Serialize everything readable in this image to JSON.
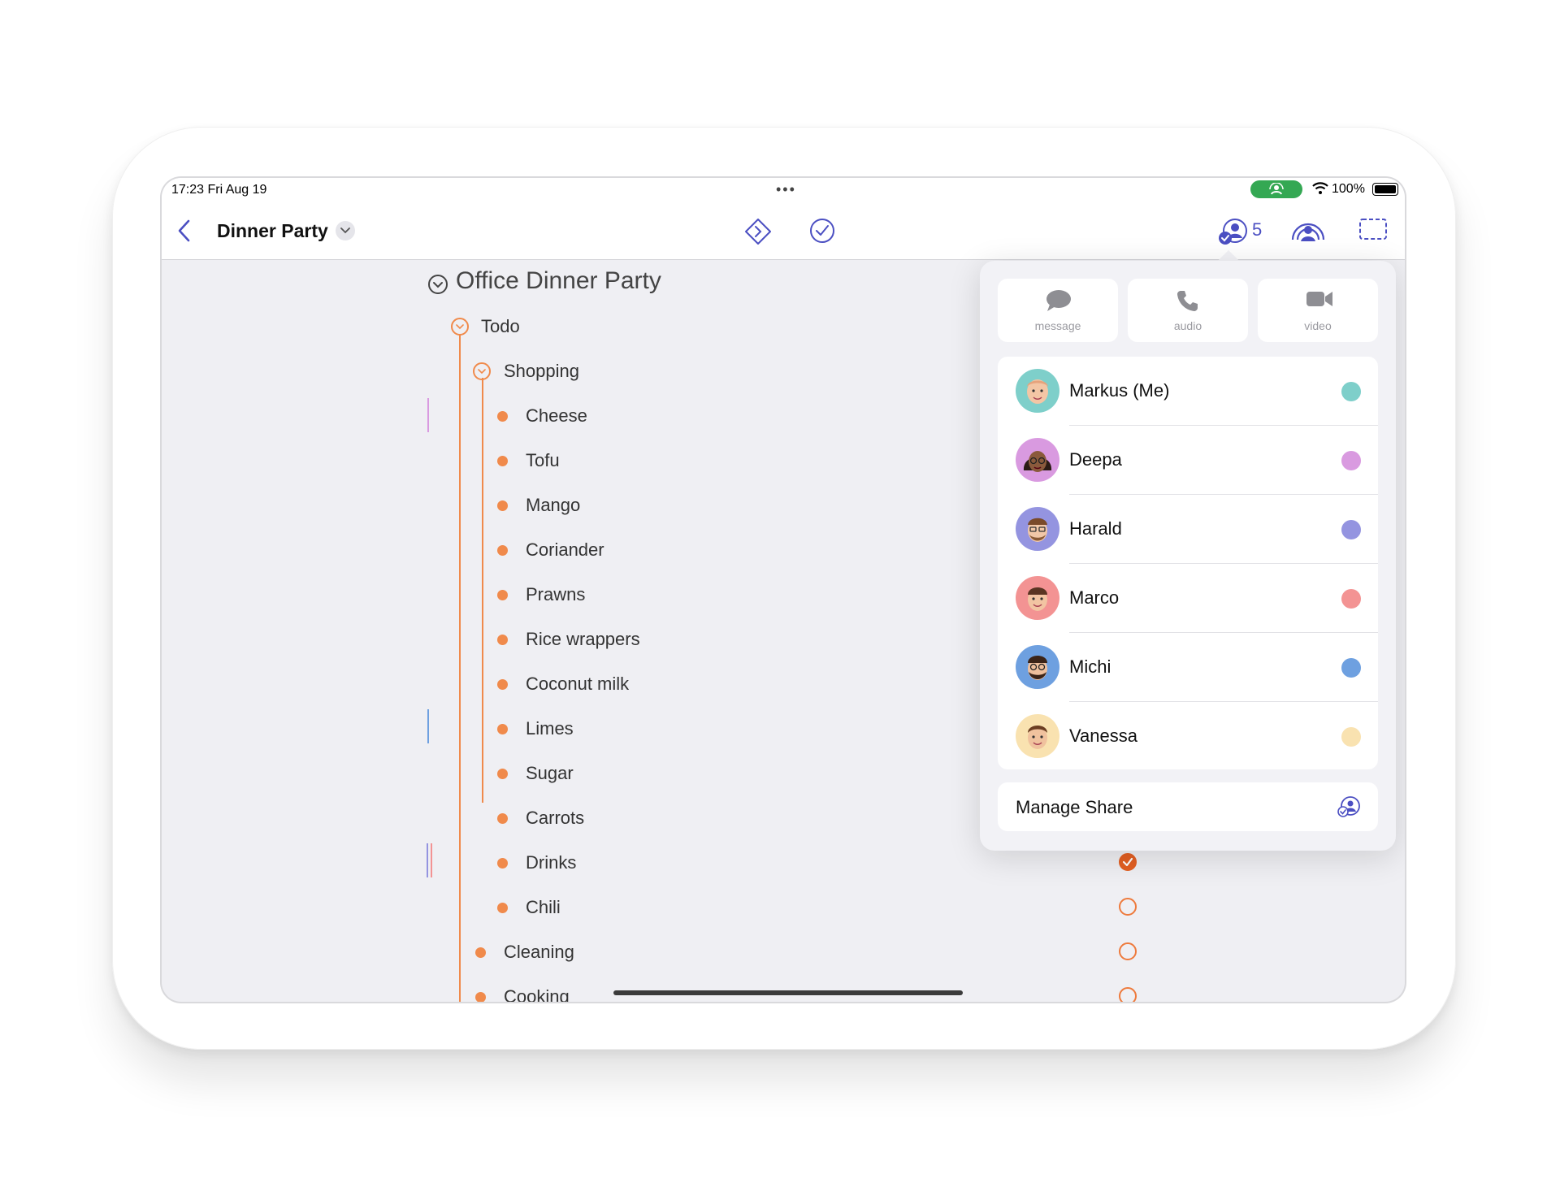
{
  "status_bar": {
    "time": "17:23  Fri Aug 19",
    "dots": "•••",
    "battery": "100%"
  },
  "nav": {
    "title": "Dinner Party",
    "share_count": "5"
  },
  "outline": {
    "root": "Office Dinner Party",
    "todo": "Todo",
    "shopping": "Shopping",
    "shopping_items": [
      "Cheese",
      "Tofu",
      "Mango",
      "Coriander",
      "Prawns",
      "Rice wrappers",
      "Coconut milk",
      "Limes",
      "Sugar",
      "Carrots",
      "Drinks",
      "Chili"
    ],
    "cleaning": "Cleaning",
    "cooking": "Cooking"
  },
  "checks": {
    "drinks": true,
    "chili": false,
    "cleaning": false,
    "cooking": false
  },
  "popover": {
    "message": "message",
    "audio": "audio",
    "video": "video",
    "people": [
      {
        "name": "Markus (Me)",
        "color": "#7ecfca"
      },
      {
        "name": "Deepa",
        "color": "#d99ae0"
      },
      {
        "name": "Harald",
        "color": "#9494e0"
      },
      {
        "name": "Marco",
        "color": "#f39393"
      },
      {
        "name": "Michi",
        "color": "#6ea0e0"
      },
      {
        "name": "Vanessa",
        "color": "#f9e2b0"
      }
    ],
    "manage_share": "Manage Share"
  },
  "colors": {
    "accent": "#4b4fc2",
    "outline_orange": "#f08a4b"
  }
}
